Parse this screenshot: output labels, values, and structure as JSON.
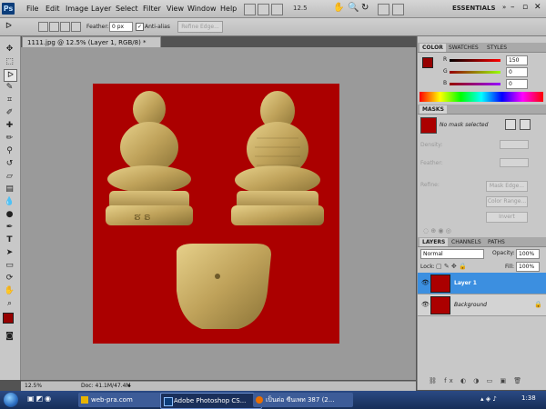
{
  "app": {
    "logo": "Ps"
  },
  "menu": {
    "items": [
      "File",
      "Edit",
      "Image",
      "Layer",
      "Select",
      "Filter",
      "View",
      "Window",
      "Help"
    ],
    "zoom": "12.5",
    "workspace": "ESSENTIALS"
  },
  "options": {
    "feather_label": "Feather:",
    "feather_value": "0 px",
    "antialias_label": "Anti-alias",
    "refine_edge_label": "Refine Edge..."
  },
  "document": {
    "tab_title": "1111.jpg @ 12.5% (Layer 1, RGB/8) *",
    "zoom": "12.5%",
    "doc_size": "Doc: 41.1M/47.4M",
    "canvas_color": "#ab0000"
  },
  "color_panel": {
    "tabs": [
      "COLOR",
      "SWATCHES",
      "STYLES"
    ],
    "r_label": "R",
    "r_value": "150",
    "g_label": "G",
    "g_value": "0",
    "b_label": "B",
    "b_value": "0",
    "foreground_color": "#960000"
  },
  "masks_panel": {
    "title": "MASKS",
    "status": "No mask selected",
    "density_label": "Density:",
    "feather_label": "Feather:",
    "refine_label": "Refine:",
    "mask_edge_button": "Mask Edge...",
    "color_range_button": "Color Range...",
    "invert_button": "Invert"
  },
  "layers_panel": {
    "tabs": [
      "LAYERS",
      "CHANNELS",
      "PATHS"
    ],
    "blend_mode": "Normal",
    "opacity_label": "Opacity:",
    "opacity_value": "100%",
    "lock_label": "Lock:",
    "fill_label": "Fill:",
    "fill_value": "100%",
    "layers": [
      {
        "name": "Layer 1",
        "selected": true
      },
      {
        "name": "Background",
        "selected": false
      }
    ]
  },
  "taskbar": {
    "tasks": [
      "web-pra.com",
      "Adobe Photoshop CS...",
      "เป็นต่อ ซีนเพท 387 (2..."
    ],
    "clock": "1:38",
    "accent": "#1f3d73"
  }
}
